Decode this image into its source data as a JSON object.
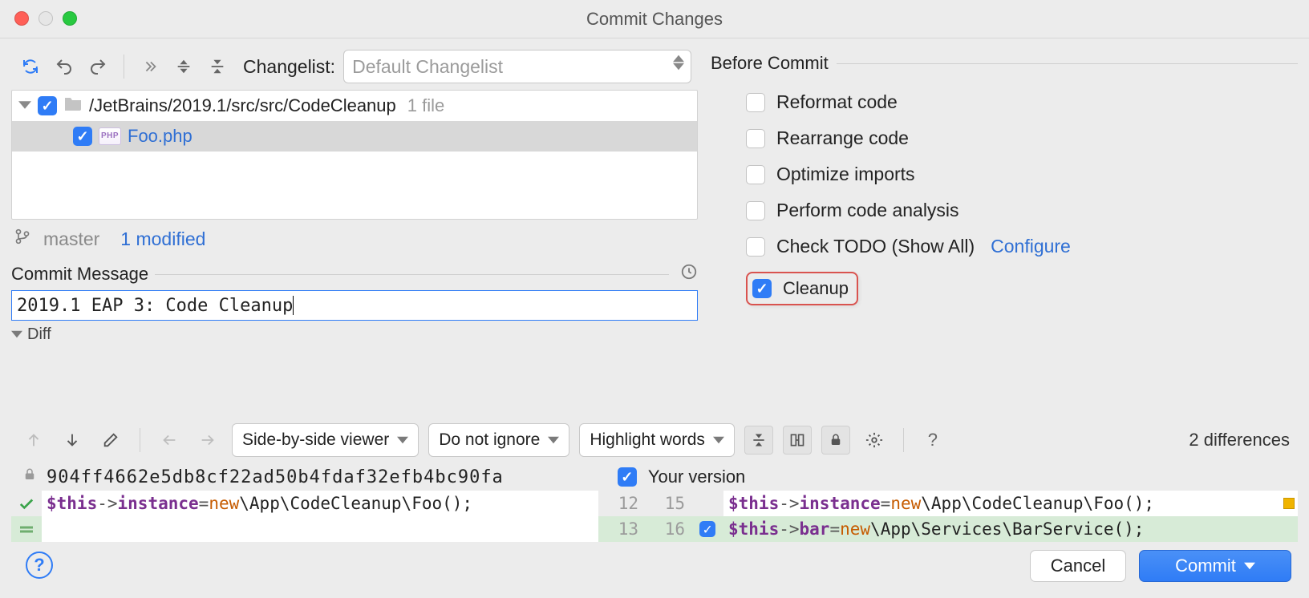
{
  "window": {
    "title": "Commit Changes"
  },
  "toolbar": {
    "changelist_label": "Changelist:",
    "changelist_selected": "Default Changelist"
  },
  "tree": {
    "path": "/JetBrains/2019.1/src/src/CodeCleanup",
    "path_meta": "1 file",
    "file_badge": "PHP",
    "file_name": "Foo.php"
  },
  "branch": {
    "name": "master",
    "modified_text": "1 modified"
  },
  "commit_message": {
    "section_title": "Commit Message",
    "text": "2019.1 EAP 3: Code Cleanup"
  },
  "diff_section": {
    "title": "Diff"
  },
  "before_commit": {
    "section_title": "Before Commit",
    "reformat": {
      "label": "Reformat code",
      "checked": false
    },
    "rearrange": {
      "label": "Rearrange code",
      "checked": false
    },
    "optimize": {
      "label": "Optimize imports",
      "checked": false
    },
    "analysis": {
      "label": "Perform code analysis",
      "checked": false
    },
    "todo": {
      "label": "Check TODO (Show All)",
      "checked": false,
      "configure": "Configure"
    },
    "cleanup": {
      "label": "Cleanup",
      "checked": true
    }
  },
  "diff_toolbar": {
    "viewer": "Side-by-side viewer",
    "ignore": "Do not ignore",
    "highlight": "Highlight words",
    "count": "2 differences",
    "help_glyph": "?"
  },
  "sxs": {
    "left_title_hash": "904ff4662e5db8cf22ad50b4fdaf32efb4bc90fa",
    "right_title": "Your version",
    "left_ln_1": "12",
    "left_ln_2": "13",
    "right_ln_1": "15",
    "right_ln_2": "16",
    "left_code_1": "$this->instance = new \\App\\CodeCleanup\\Foo();",
    "right_code_1": "$this->instance = new \\App\\CodeCleanup\\Foo();",
    "right_code_2": "$this->bar = new \\App\\Services\\BarService();"
  },
  "footer": {
    "cancel": "Cancel",
    "commit": "Commit",
    "help_glyph": "?"
  }
}
